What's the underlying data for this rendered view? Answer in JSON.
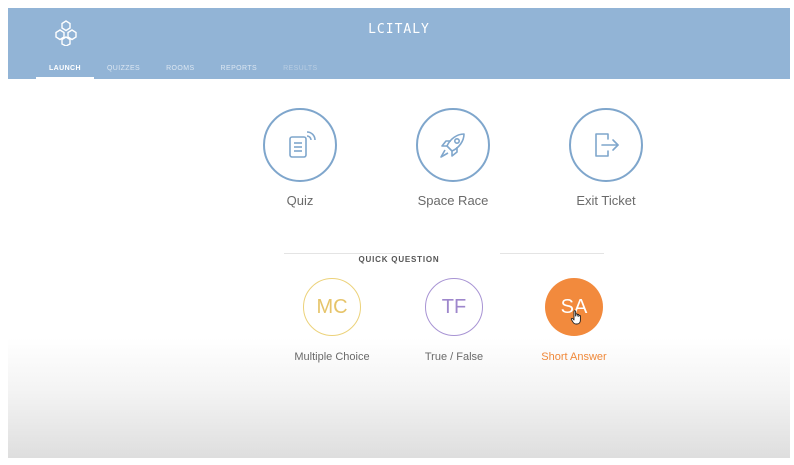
{
  "app": {
    "title": "LCITALY"
  },
  "nav": {
    "tabs": [
      "LAUNCH",
      "QUIZZES",
      "ROOMS",
      "REPORTS",
      "RESULTS"
    ],
    "active": "LAUNCH"
  },
  "launch": {
    "quiz": {
      "label": "Quiz",
      "icon": "quiz-icon"
    },
    "space_race": {
      "label": "Space Race",
      "icon": "rocket-icon"
    },
    "exit_ticket": {
      "label": "Exit Ticket",
      "icon": "exit-icon"
    }
  },
  "quick_question": {
    "title": "QUICK QUESTION",
    "mc": {
      "abbr": "MC",
      "label": "Multiple Choice"
    },
    "tf": {
      "abbr": "TF",
      "label": "True / False"
    },
    "sa": {
      "abbr": "SA",
      "label": "Short Answer"
    }
  },
  "colors": {
    "header": "#92b4d6",
    "accent_blue": "#7fa6cc",
    "mc": "#e6c46a",
    "tf": "#9e87cc",
    "sa": "#f28a3d"
  }
}
